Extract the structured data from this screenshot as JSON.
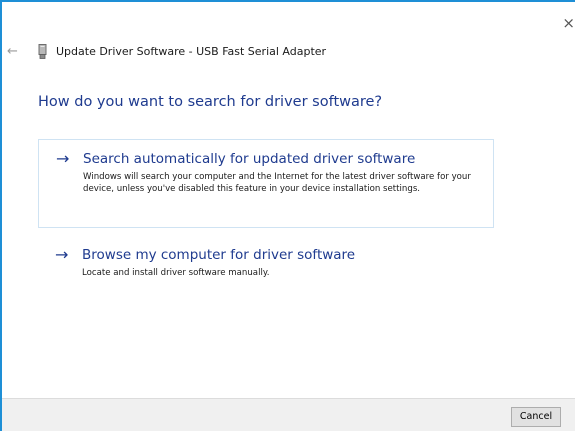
{
  "window": {
    "title": "Update Driver Software - USB Fast Serial Adapter",
    "close_icon": "close-icon",
    "back_icon": "back-arrow-icon",
    "device_icon": "usb-device-icon"
  },
  "heading": "How do you want to search for driver software?",
  "options": [
    {
      "icon": "arrow-right-icon",
      "title": "Search automatically for updated driver software",
      "description": "Windows will search your computer and the Internet for the latest driver software for your device, unless you've disabled this feature in your device installation settings."
    },
    {
      "icon": "arrow-right-icon",
      "title": "Browse my computer for driver software",
      "description": "Locate and install driver software manually."
    }
  ],
  "footer": {
    "cancel_label": "Cancel"
  },
  "colors": {
    "accent": "#1f3b8f",
    "border": "#1e8fd6",
    "option_border": "#cfe3f3",
    "footer_bg": "#f0f0f0"
  },
  "glyphs": {
    "close": "×",
    "back": "←",
    "arrow": "→"
  }
}
